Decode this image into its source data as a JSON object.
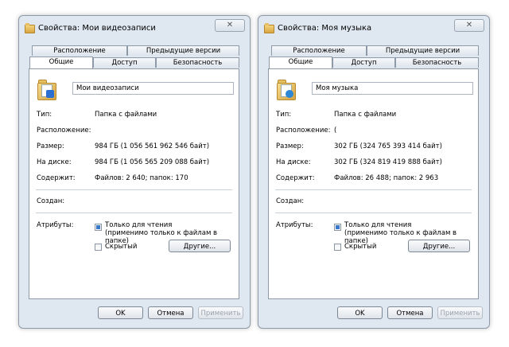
{
  "windows": [
    {
      "title": "Свойства: Мои видеозаписи",
      "close": "✕",
      "tabs_row1": [
        "Расположение",
        "Предыдущие версии"
      ],
      "tabs_row2": [
        "Общие",
        "Доступ",
        "Безопасность"
      ],
      "name": "Мои видеозаписи",
      "labels": {
        "type": "Тип:",
        "location": "Расположение:",
        "size": "Размер:",
        "on_disk": "На диске:",
        "contains": "Содержит:",
        "created": "Создан:",
        "attributes": "Атрибуты:"
      },
      "values": {
        "type": "Папка с файлами",
        "location": "",
        "size": "984 ГБ (1 056 561 962 546 байт)",
        "on_disk": "984 ГБ (1 056 565 209 088 байт)",
        "contains": "Файлов: 2 640; папок: 170",
        "created": ""
      },
      "readonly_line1": "Только для чтения",
      "readonly_line2": "(применимо только к файлам в папке)",
      "hidden": "Скрытый",
      "other_button": "Другие...",
      "ok": "OK",
      "cancel": "Отмена",
      "apply": "Применить"
    },
    {
      "title": "Свойства: Моя музыка",
      "close": "✕",
      "tabs_row1": [
        "Расположение",
        "Предыдущие версии"
      ],
      "tabs_row2": [
        "Общие",
        "Доступ",
        "Безопасность"
      ],
      "name": "Моя музыка",
      "labels": {
        "type": "Тип:",
        "location": "Расположение:",
        "size": "Размер:",
        "on_disk": "На диске:",
        "contains": "Содержит:",
        "created": "Создан:",
        "attributes": "Атрибуты:"
      },
      "values": {
        "type": "Папка с файлами",
        "location": "(",
        "size": "302 ГБ (324 765 393 414 байт)",
        "on_disk": "302 ГБ (324 819 419 888 байт)",
        "contains": "Файлов: 26 488; папок: 2 963",
        "created": ""
      },
      "readonly_line1": "Только для чтения",
      "readonly_line2": "(применимо только к файлам в папке)",
      "hidden": "Скрытый",
      "other_button": "Другие...",
      "ok": "OK",
      "cancel": "Отмена",
      "apply": "Применить"
    }
  ]
}
